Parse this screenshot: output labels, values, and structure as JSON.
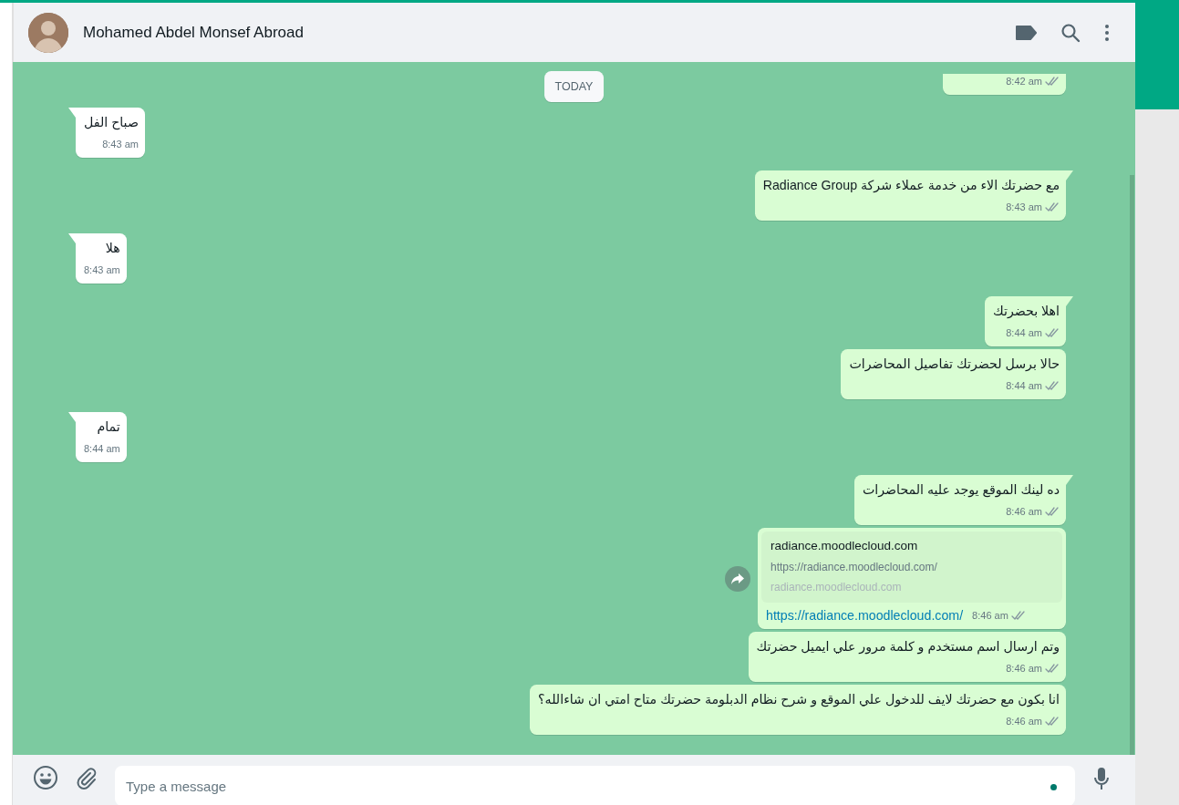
{
  "header": {
    "contact_name": "Mohamed Abdel Monsef Abroad"
  },
  "date_chip": "TODAY",
  "messages": [
    {
      "kind": "cut",
      "outgoing": true,
      "tail": false,
      "time": "8:42 am",
      "read": false
    },
    {
      "kind": "text",
      "outgoing": false,
      "tail": true,
      "text": "صباح الفل",
      "time": "8:43 am"
    },
    {
      "kind": "text",
      "outgoing": true,
      "tail": true,
      "text": "مع حضرتك الاء من خدمة عملاء شركة Radiance Group",
      "time": "8:43 am",
      "read": false
    },
    {
      "kind": "text",
      "outgoing": false,
      "tail": true,
      "text": "هلا",
      "time": "8:43 am"
    },
    {
      "kind": "text",
      "outgoing": true,
      "tail": true,
      "text": "اهلا بحضرتك",
      "time": "8:44 am",
      "read": false
    },
    {
      "kind": "text",
      "outgoing": true,
      "tail": false,
      "text": "حالا برسل لحضرتك تفاصيل المحاضرات",
      "time": "8:44 am",
      "read": false
    },
    {
      "kind": "text",
      "outgoing": false,
      "tail": true,
      "text": "تمام",
      "time": "8:44 am"
    },
    {
      "kind": "text",
      "outgoing": true,
      "tail": true,
      "text": "ده لينك الموقع يوجد عليه المحاضرات",
      "time": "8:46 am",
      "read": false
    },
    {
      "kind": "link",
      "outgoing": true,
      "tail": false,
      "show_forward": true,
      "preview": {
        "title": "radiance.moodlecloud.com",
        "description": "https://radiance.moodlecloud.com/",
        "domain": "radiance.moodlecloud.com"
      },
      "text": "https://radiance.moodlecloud.com/",
      "time": "8:46 am",
      "read": false
    },
    {
      "kind": "text",
      "outgoing": true,
      "tail": false,
      "text": "وتم ارسال اسم مستخدم و كلمة مرور علي ايميل حضرتك",
      "time": "8:46 am",
      "read": false
    },
    {
      "kind": "text",
      "outgoing": true,
      "tail": false,
      "text": "انا بكون مع حضرتك لايف للدخول علي الموقع و شرح نظام الدبلومة حضرتك متاح امتي ان شاءالله؟",
      "time": "8:46 am",
      "read": false
    }
  ],
  "composer": {
    "placeholder": "Type a message"
  }
}
